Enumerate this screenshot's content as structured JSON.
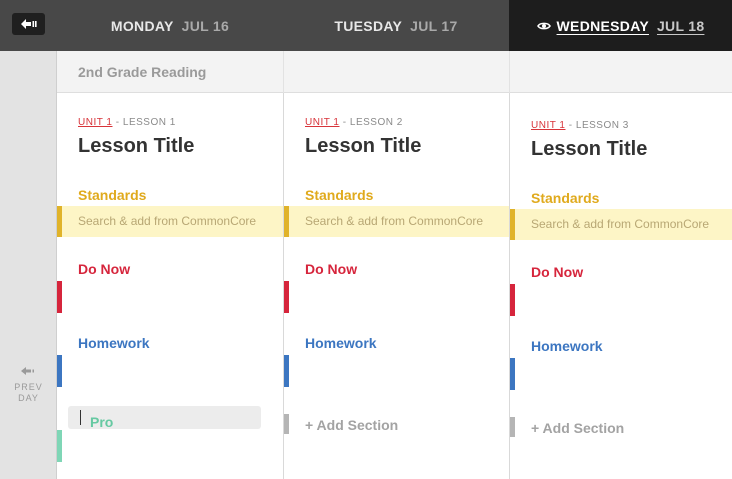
{
  "sidebar": {
    "collapse_icon": "arrow-left-bar-icon",
    "prev_label_1": "PREV",
    "prev_label_2": "DAY"
  },
  "days": [
    {
      "name": "MONDAY",
      "date": "JUL 16"
    },
    {
      "name": "TUESDAY",
      "date": "JUL 17"
    },
    {
      "name": "WEDNESDAY",
      "date": "JUL 18"
    }
  ],
  "active_day_icon": "eye-icon",
  "class_name": "2nd Grade Reading",
  "columns": [
    {
      "unit": "UNIT 1",
      "lesson": "- LESSON 1",
      "title": "Lesson Title",
      "standards_label": "Standards",
      "standards_placeholder": "Search & add from CommonCore",
      "donow_label": "Do Now",
      "homework_label": "Homework",
      "new_section_value": "Pro"
    },
    {
      "unit": "UNIT 1",
      "lesson": "- LESSON 2",
      "title": "Lesson Title",
      "standards_label": "Standards",
      "standards_placeholder": "Search & add from CommonCore",
      "donow_label": "Do Now",
      "homework_label": "Homework",
      "add_section": "+ Add Section"
    },
    {
      "unit": "UNIT 1",
      "lesson": "- LESSON 3",
      "title": "Lesson Title",
      "standards_label": "Standards",
      "standards_placeholder": "Search & add from CommonCore",
      "donow_label": "Do Now",
      "homework_label": "Homework",
      "add_section": "+ Add Section"
    }
  ],
  "colors": {
    "standards": "#e0aa1d",
    "donow": "#d6253c",
    "homework": "#3c76c1",
    "new_section": "#66c9a2",
    "unit": "#d8343a"
  }
}
